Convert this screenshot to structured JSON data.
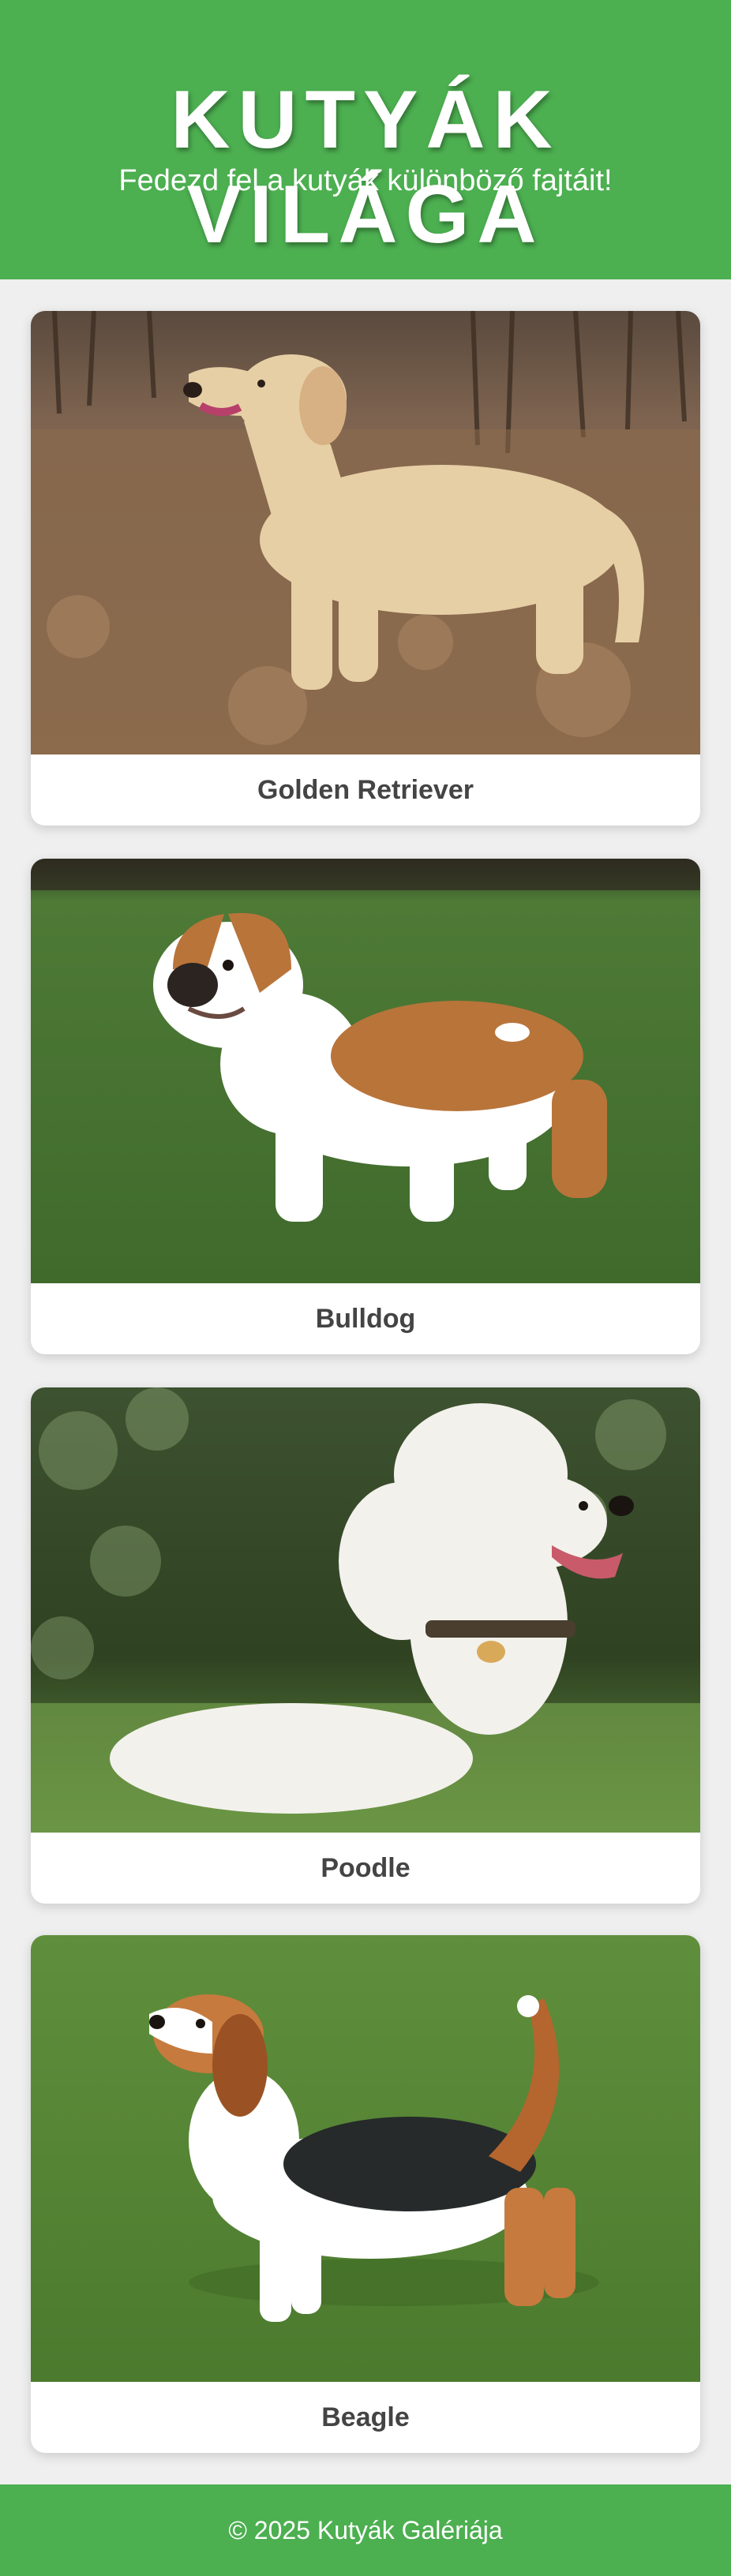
{
  "header": {
    "title": "KUTYÁK VILÁGA",
    "subtitle": "Fedezd fel a kutyák különböző fajtáit!",
    "background_color": "#4caf50"
  },
  "gallery": {
    "cards": [
      {
        "breed": "Golden Retriever",
        "photo": "golden-retriever-photo"
      },
      {
        "breed": "Bulldog",
        "photo": "bulldog-photo"
      },
      {
        "breed": "Poodle",
        "photo": "poodle-photo"
      },
      {
        "breed": "Beagle",
        "photo": "beagle-photo"
      }
    ]
  },
  "footer": {
    "text": "© 2025 Kutyák Galériája",
    "background_color": "#4caf50"
  }
}
